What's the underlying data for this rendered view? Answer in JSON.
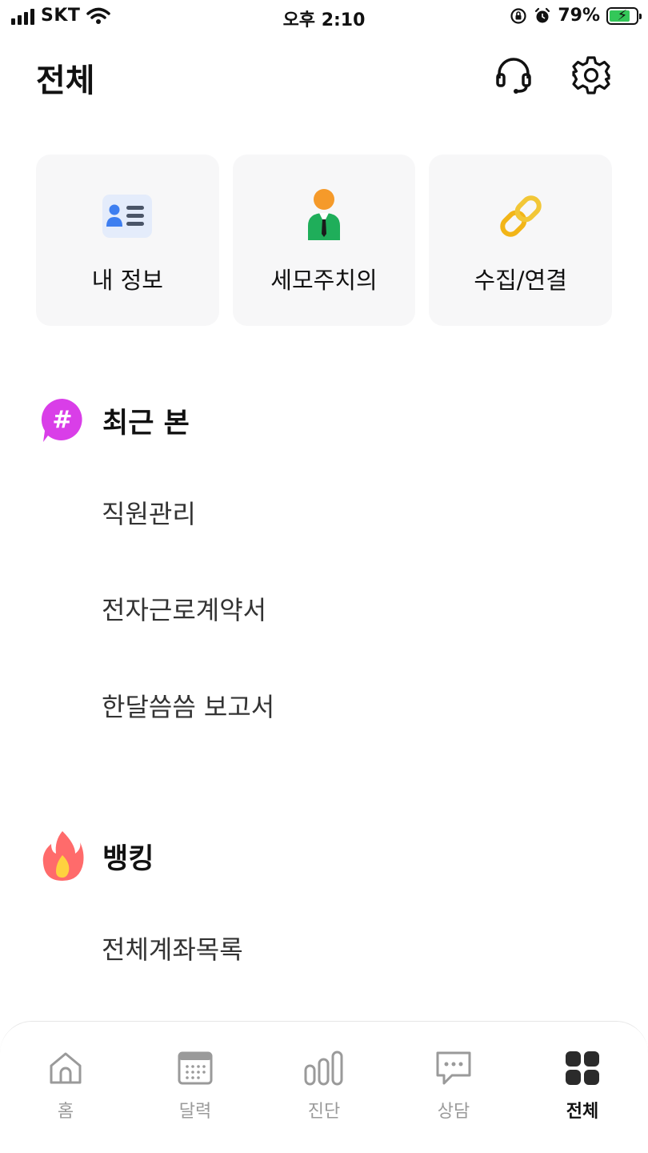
{
  "status_bar": {
    "carrier": "SKT",
    "time": "오후 2:10",
    "battery_percent": "79%"
  },
  "header": {
    "title": "전체"
  },
  "shortcuts": [
    {
      "label": "내 정보",
      "icon": "id-card-icon"
    },
    {
      "label": "세모주치의",
      "icon": "doctor-icon"
    },
    {
      "label": "수집/연결",
      "icon": "chain-link-icon"
    }
  ],
  "recent": {
    "title": "최근 본",
    "items": [
      "직원관리",
      "전자근로계약서",
      "한달씀씀 보고서"
    ]
  },
  "banking": {
    "title": "뱅킹",
    "items": [
      "전체계좌목록"
    ]
  },
  "bottom_nav": {
    "items": [
      {
        "label": "홈",
        "icon": "home-icon"
      },
      {
        "label": "달력",
        "icon": "calendar-icon"
      },
      {
        "label": "진단",
        "icon": "bar-chart-icon"
      },
      {
        "label": "상담",
        "icon": "chat-icon"
      },
      {
        "label": "전체",
        "icon": "grid-icon"
      }
    ],
    "active": "전체"
  },
  "colors": {
    "accent": "#111111",
    "card_bg": "#f7f7f8",
    "inactive": "#9a9a9a",
    "hash_badge": "#d93ee8",
    "flame": "#ff6b6b"
  }
}
